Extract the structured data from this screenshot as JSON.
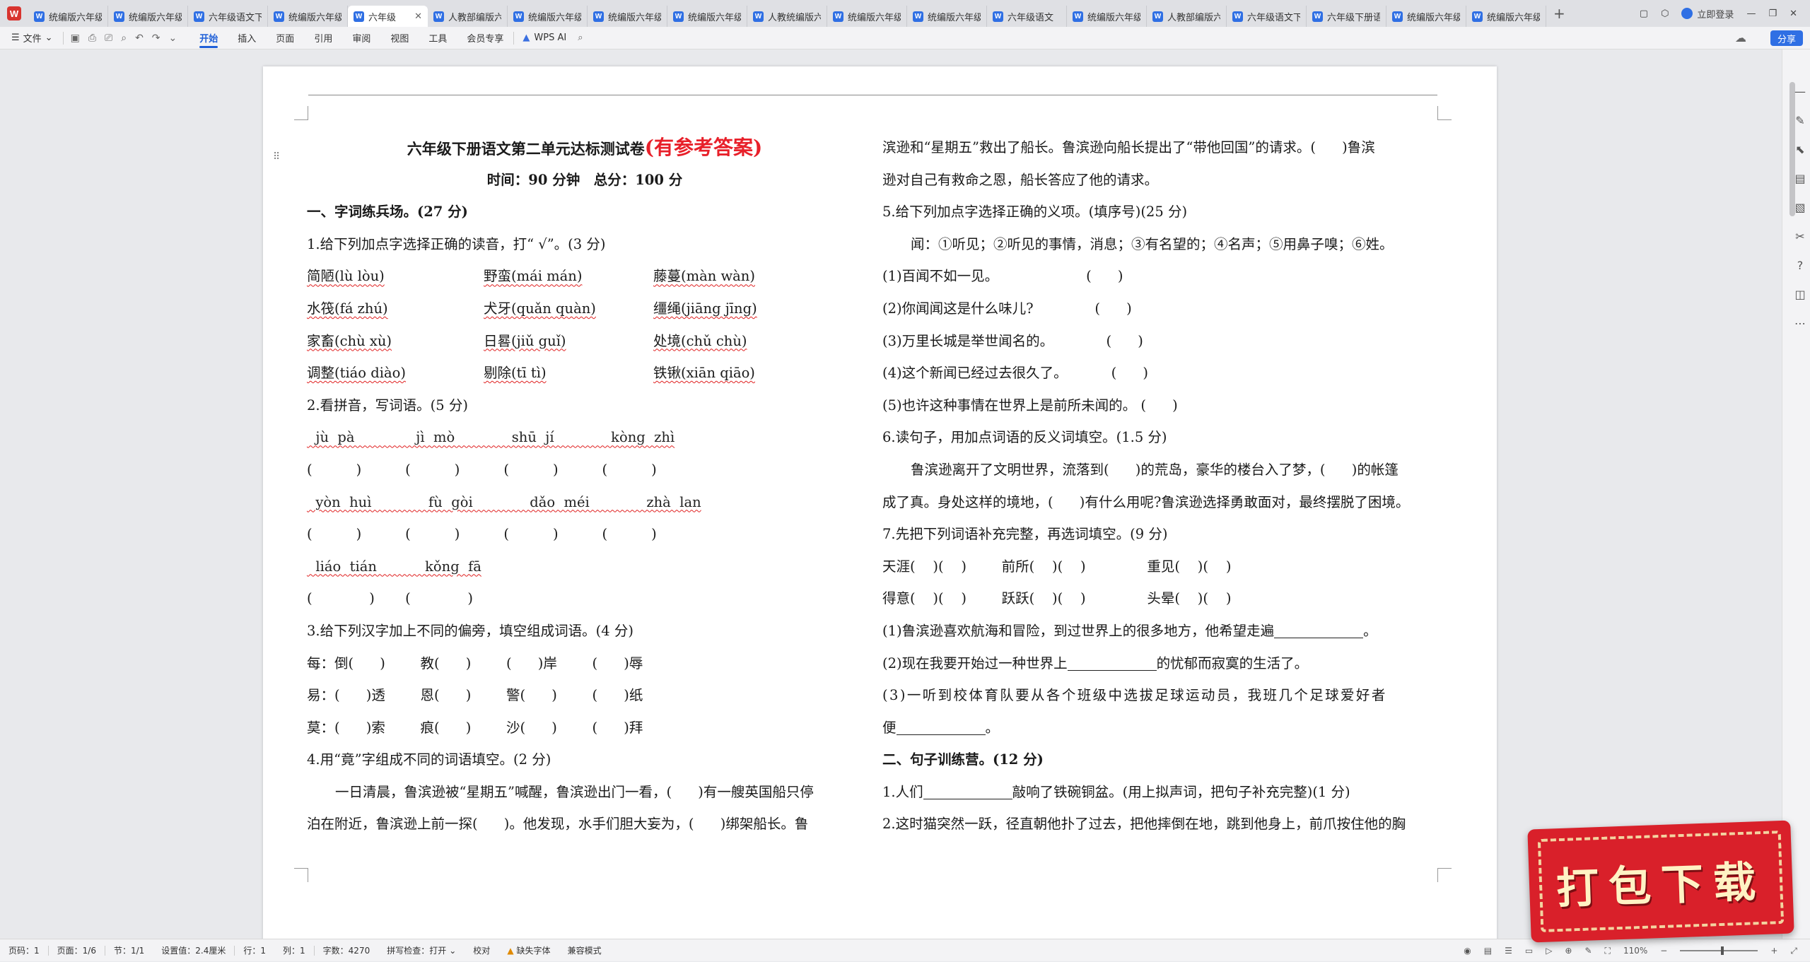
{
  "tabbar": {
    "logo_label": "W",
    "tabs": [
      {
        "label": "统编版六年级"
      },
      {
        "label": "统编版六年级"
      },
      {
        "label": "六年级语文下"
      },
      {
        "label": "统编版六年级"
      },
      {
        "label": "六年级",
        "active": true
      },
      {
        "label": "人教部编版六"
      },
      {
        "label": "统编版六年级"
      },
      {
        "label": "统编版六年级"
      },
      {
        "label": "统编版六年级"
      },
      {
        "label": "人教统编版六"
      },
      {
        "label": "统编版六年级"
      },
      {
        "label": "统编版六年级"
      },
      {
        "label": "六年级语文"
      },
      {
        "label": "统编版六年级"
      },
      {
        "label": "人教部编版六"
      },
      {
        "label": "六年级语文下"
      },
      {
        "label": "六年级下册语"
      },
      {
        "label": "统编版六年级"
      },
      {
        "label": "统编版六年级"
      }
    ],
    "new_tab": "+",
    "login": "立即登录"
  },
  "ribbon": {
    "file_menu": "文件",
    "tabs": [
      "开始",
      "插入",
      "页面",
      "引用",
      "审阅",
      "视图",
      "工具",
      "会员专享"
    ],
    "active_tab": "开始",
    "wps_ai": "WPS AI",
    "share": "分享"
  },
  "doc": {
    "title": "六年级下册语文第二单元达标测试卷",
    "title_suffix": "(有参考答案)",
    "subtitle": "时间：90 分钟　总分：100 分",
    "left": {
      "s1_head": "一、字词练兵场。(27 分)",
      "q1": "1.给下列加点字选择正确的读音，打“ √”。(3 分)",
      "q1_rows": [
        [
          "简陋(lù  lòu)",
          "野蛮(mái  mán)",
          "藤蔓(màn  wàn)"
        ],
        [
          "水筏(fá  zhú)",
          "犬牙(quǎn  quàn)",
          "缰绳(jiāng  jīng)"
        ],
        [
          "家畜(chù  xù)",
          "日晷(jiǔ  guǐ)",
          "处境(chǔ  chù)"
        ],
        [
          "调整(tiáo  diào)",
          "剔除(tī  tì)",
          "铁锹(xiān  qiāo)"
        ]
      ],
      "q2": "2.看拼音，写词语。(5 分)",
      "q2_py1": "  jù  pà              jì  mò             shū  jí             kòng  zhì",
      "q2_bk1": "(          )          (          )          (          )          (          )",
      "q2_py2": "  yòn  huì             fù  gòi             dǎo  méi             zhà  lan",
      "q2_bk2": "(          )          (          )          (          )          (          )",
      "q2_py3": "  liáo  tián           kǒng  fā",
      "q2_bk3": "(             )       (             )",
      "q3": "3.给下列汉字加上不同的偏旁，填空组成词语。(4 分)",
      "q3_r1": "每：倒(      )        教(      )        (      )岸        (      )辱",
      "q3_r2": "易：(      )透        恩(      )        警(      )        (      )纸",
      "q3_r3": "莫：(      )索        痕(      )        沙(      )        (      )拜",
      "q4": "4.用“竟”字组成不同的词语填空。(2 分)",
      "q4_p1": "一日清晨，鲁滨逊被“星期五”喊醒，鲁滨逊出门一看，(      )有一艘英国船只停",
      "q4_p2": "泊在附近，鲁滨逊上前一探(      )。他发现，水手们胆大妄为，(      )绑架船长。鲁"
    },
    "right": {
      "c1": "滨逊和“星期五”救出了船长。鲁滨逊向船长提出了“带他回国”的请求。(      )鲁滨",
      "c2": "逊对自己有救命之恩，船长答应了他的请求。",
      "q5": "5.给下列加点字选择正确的义项。(填序号)(25 分)",
      "q5_def": "闻：①听见；②听见的事情，消息；③有名望的；④名声；⑤用鼻子嗅；⑥姓。",
      "q5_items": [
        "(1)百闻不如一见。                    (      )",
        "(2)你闻闻这是什么味儿?              (      )",
        "(3)万里长城是举世闻名的。            (      )",
        "(4)这个新闻已经过去很久了。          (      )",
        "(5)也许这种事情在世界上是前所未闻的。 (      )"
      ],
      "q6": "6.读句子，用加点词语的反义词填空。(1.5 分)",
      "q6_p1": "鲁滨逊离开了文明世界，流落到(      )的荒岛，豪华的楼台入了梦，(      )的帐篷",
      "q6_p2": "成了真。身处这样的境地，(      )有什么用呢?鲁滨逊选择勇敢面对，最终摆脱了困境。",
      "q7": "7.先把下列词语补充完整，再选词填空。(9 分)",
      "q7_r1": "天涯(    )(    )        前所(    )(    )              重见(    )(    )",
      "q7_r2": "得意(    )(    )        跃跃(    )(    )              头晕(    )(    )",
      "q7_s1a": "(1)鲁滨逊喜欢航海和冒险，到过世界上的很多地方，他希望走遍",
      "q7_s1b": "。",
      "q7_s2a": "(2)现在我要开始过一种世界上",
      "q7_s2b": "的忧郁而寂寞的生活了。",
      "q7_s3a": "(3)一听到校体育队要从各个班级中选拔足球运动员，我班几个足球爱好者",
      "q7_s3b": "便",
      "q7_s3c": "。",
      "s2_head": "二、句子训练营。(12 分)",
      "s2_q1a": "1.人们",
      "s2_q1b": "敲响了铁碗铜盆。(用上拟声词，把句子补充完整)(1 分)",
      "s2_q2": "2.这时猫突然一跃，径直朝他扑了过去，把他摔倒在地，跳到他身上，前爪按住他的胸"
    }
  },
  "status": {
    "page_code": "页码：1",
    "page": "页面：1/6",
    "section": "节：1/1",
    "setting": "设置值：2.4厘米",
    "row": "行：1",
    "col": "列：1",
    "words": "字数：4270",
    "spell": "拼写检查：打开",
    "proof": "校对",
    "missing_font": "缺失字体",
    "compat": "兼容模式",
    "zoom": "110%"
  },
  "banner": {
    "text": "打包下载"
  }
}
